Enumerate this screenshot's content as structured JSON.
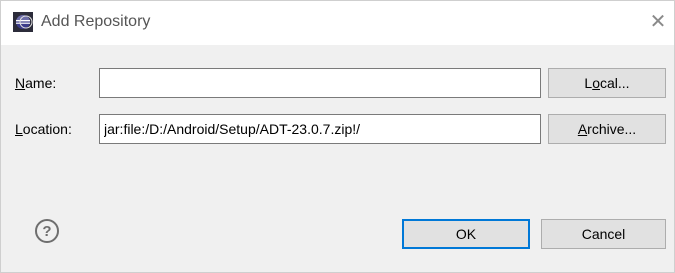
{
  "window": {
    "title": "Add Repository",
    "close_glyph": "✕",
    "icon": "eclipse-icon"
  },
  "form": {
    "name_label_key": "N",
    "name_label_rest": "ame:",
    "name_value": "",
    "location_label_key": "L",
    "location_label_rest": "ocation:",
    "location_value": "jar:file:/D:/Android/Setup/ADT-23.0.7.zip!/"
  },
  "buttons": {
    "local_pre": "L",
    "local_key": "o",
    "local_post": "cal...",
    "archive_key": "A",
    "archive_post": "rchive...",
    "ok": "OK",
    "cancel": "Cancel",
    "help_glyph": "?"
  },
  "colors": {
    "default_button_border": "#0078d7",
    "dialog_bg": "#f0f0f0"
  }
}
